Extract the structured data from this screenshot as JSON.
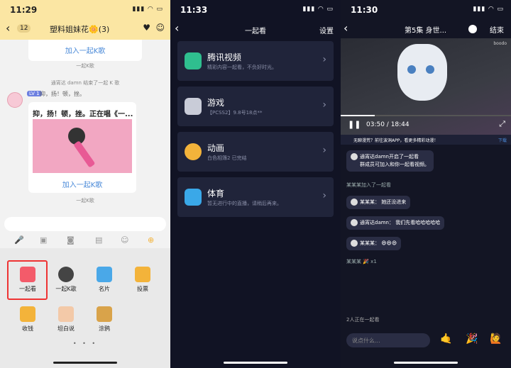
{
  "phone1": {
    "status_time": "11:29",
    "back_count": "12",
    "chat_title": "塑料姐妹花🌼(3)",
    "card_top_link": "加入一起K歌",
    "sys_end_time": "一起K歌",
    "sys_end_text": "通宵达 damn 结束了一起 K 歌",
    "user_level": "LV 1",
    "user_name": "抑，扬！顿，挫。",
    "card_title": "抑，扬！顿，挫。正在唱《一...",
    "card_link": "加入一起K歌",
    "sys_bottom": "一起K歌",
    "grid": [
      {
        "label": "一起看",
        "color": "#f35b6a"
      },
      {
        "label": "一起K歌",
        "color": "#444"
      },
      {
        "label": "名片",
        "color": "#4aa8e8"
      },
      {
        "label": "投票",
        "color": "#f3b33a"
      },
      {
        "label": "收钱",
        "color": "#f3b33a"
      },
      {
        "label": "坦白说",
        "color": "#f3c9a8"
      },
      {
        "label": "涂鸦",
        "color": "#d9a34a"
      }
    ],
    "page_dots": "• • •"
  },
  "phone2": {
    "status_time": "11:33",
    "title": "一起看",
    "settings": "设置",
    "rows": [
      {
        "title": "腾讯视频",
        "sub": "精彩内容一起看，不负好时光。",
        "color": "#2fbf8f"
      },
      {
        "title": "游戏",
        "sub": "【PCSS2】9.8号18点**",
        "color": "#c9ccd8"
      },
      {
        "title": "动画",
        "sub": "白色相簿2 已完结",
        "color": "#f3b33a"
      },
      {
        "title": "体育",
        "sub": "暂无进行中的直播，请稍后再来。",
        "color": "#3aa8e8"
      }
    ]
  },
  "phone3": {
    "status_time": "11:30",
    "title": "第5集 身世...",
    "end": "结束",
    "watermark": "boodo",
    "video_time": "03:50 / 18:44",
    "progress": 0.2,
    "ad_text": "无聊漫荒？前往波洞APP，看更多精彩动漫！",
    "ad_download": "下载",
    "msg1_line1": "通宵达damn开启了一起看",
    "msg1_line2": "群成员可加入和你一起看视频。",
    "join_text": "某某某加入了一起看",
    "m2": "某某某：  她还没进来",
    "m3": "通宵达damn：  我们先看哈哈哈哈哈",
    "m4": "某某某：  😄😄😄",
    "gift_name": "某某某",
    "gift_count": "x1",
    "watching": "2人正在一起看",
    "input_placeholder": "说点什么...",
    "emojis": [
      "🤙",
      "🎉",
      "🙋"
    ]
  }
}
